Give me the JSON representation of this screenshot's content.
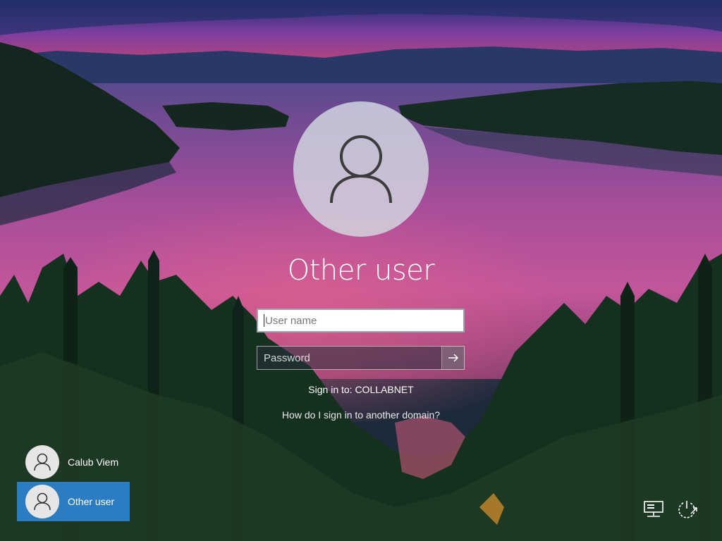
{
  "login": {
    "selected_user": "Other user",
    "username_placeholder": "User name",
    "password_placeholder": "Password",
    "sign_in_to": "Sign in to: COLLABNET",
    "domain_help_link": "How do I sign in to another domain?"
  },
  "users": [
    {
      "name": "Calub Viem",
      "icon": "user-icon",
      "selected": false
    },
    {
      "name": "Other user",
      "icon": "user-icon",
      "selected": true
    }
  ],
  "corner_icons": [
    "network-icon",
    "power-icon"
  ],
  "colors": {
    "selected_tile": "#2c7cc2",
    "avatar_bg": "#d6dce4",
    "sky_purple": "#7a3ea0",
    "lake_pink": "#c2569a",
    "forest_green": "#1d3a2c"
  }
}
